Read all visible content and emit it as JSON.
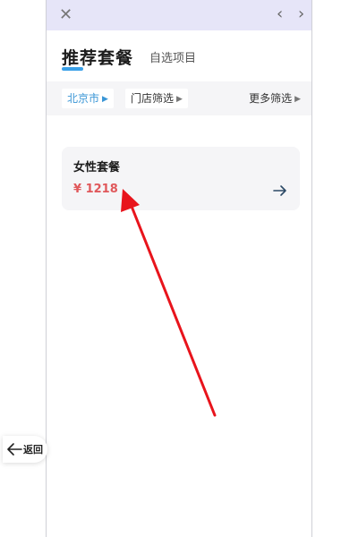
{
  "topbar": {
    "close_glyph": "✕",
    "back_glyph": "‹",
    "forward_glyph": "›"
  },
  "tabs": {
    "main": "推荐套餐",
    "secondary": "自选项目"
  },
  "filters": {
    "city": "北京市",
    "store": "门店筛选",
    "more": "更多筛选"
  },
  "card": {
    "title": "女性套餐",
    "price": "¥ 1218"
  },
  "back_button": {
    "label": "返回"
  },
  "colors": {
    "accent_blue": "#3aa0e8",
    "price_red": "#e0585b",
    "annotation_arrow": "#e8141c"
  },
  "icons": {
    "close": "close-icon",
    "back": "chevron-left-icon",
    "forward": "chevron-right-icon",
    "card_arrow": "arrow-right-icon",
    "float_back": "arrow-left-icon"
  }
}
